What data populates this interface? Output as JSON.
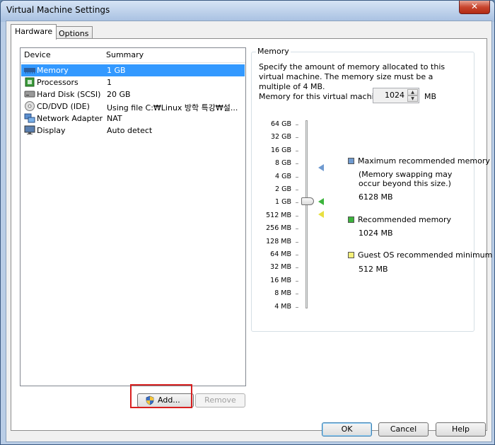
{
  "window": {
    "title": "Virtual Machine Settings",
    "close_label": "✕"
  },
  "tabs": [
    {
      "label": "Hardware"
    },
    {
      "label": "Options"
    }
  ],
  "device_list": {
    "headers": {
      "device": "Device",
      "summary": "Summary"
    },
    "rows": [
      {
        "device": "Memory",
        "summary": "1 GB",
        "icon": "memory-icon",
        "selected": true
      },
      {
        "device": "Processors",
        "summary": "1",
        "icon": "processor-icon"
      },
      {
        "device": "Hard Disk (SCSI)",
        "summary": "20 GB",
        "icon": "hard-disk-icon"
      },
      {
        "device": "CD/DVD (IDE)",
        "summary": "Using file C:₩Linux 방학 특강₩설...",
        "icon": "cd-dvd-icon"
      },
      {
        "device": "Network Adapter",
        "summary": "NAT",
        "icon": "network-adapter-icon"
      },
      {
        "device": "Display",
        "summary": "Auto detect",
        "icon": "display-icon"
      }
    ]
  },
  "buttons": {
    "add": "Add...",
    "remove": "Remove",
    "ok": "OK",
    "cancel": "Cancel",
    "help": "Help"
  },
  "memory": {
    "group_title": "Memory",
    "description": "Specify the amount of memory allocated to this virtual machine. The memory size must be a multiple of 4 MB.",
    "field_label": "Memory for this virtual machine:",
    "value": "1024",
    "unit": "MB",
    "scale_labels": [
      "64 GB",
      "32 GB",
      "16 GB",
      "8 GB",
      "4 GB",
      "2 GB",
      "1 GB",
      "512 MB",
      "256 MB",
      "128 MB",
      "64 MB",
      "32 MB",
      "16 MB",
      "8 MB",
      "4 MB"
    ],
    "slider_position_label": "1 GB",
    "legend": {
      "max": {
        "label": "Maximum recommended memory",
        "note_1": "(Memory swapping may",
        "note_2": "occur beyond this size.)",
        "value": "6128 MB",
        "color": "#6f9ad0"
      },
      "recommended": {
        "label": "Recommended memory",
        "value": "1024 MB",
        "color": "#3cb43c"
      },
      "guest_min": {
        "label": "Guest OS recommended minimum",
        "value": "512 MB",
        "color": "#f5f07a"
      }
    }
  }
}
